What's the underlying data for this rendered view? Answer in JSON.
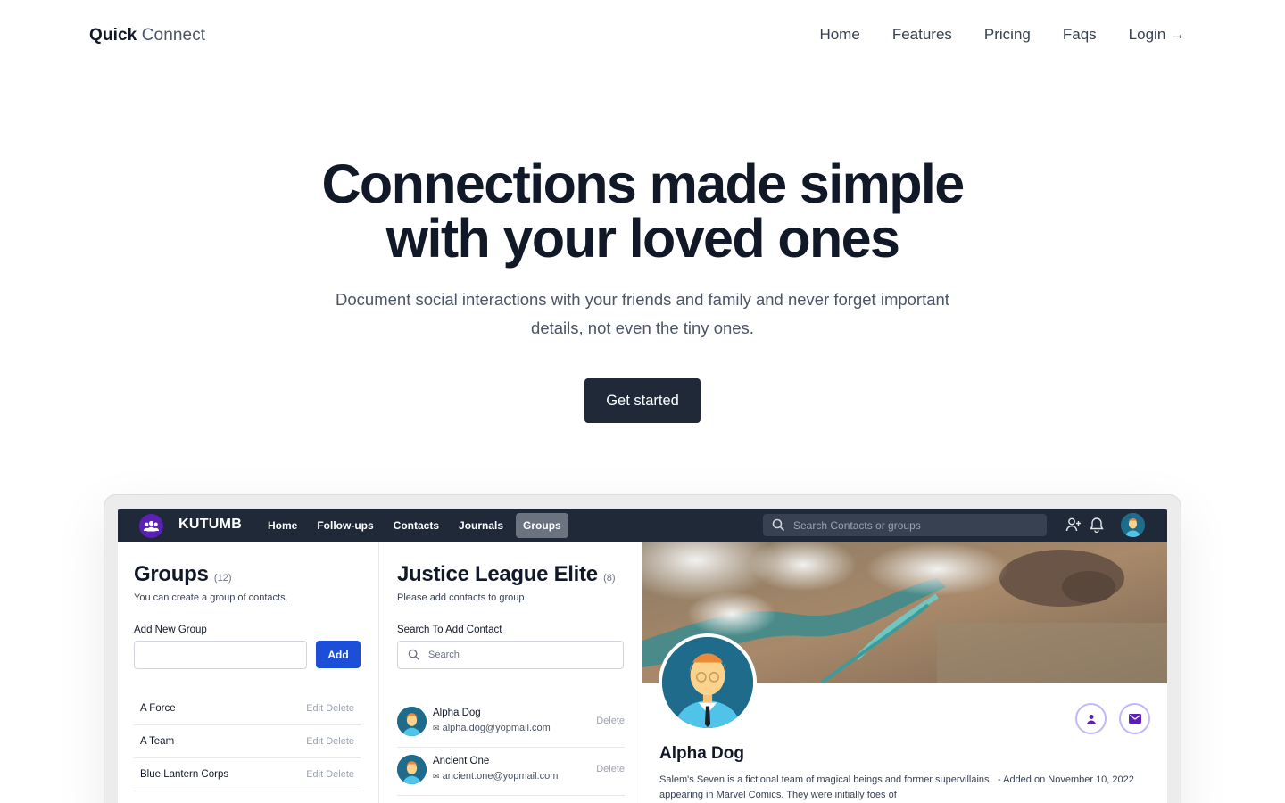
{
  "site": {
    "brand_bold": "Quick",
    "brand_light": "Connect",
    "nav": [
      "Home",
      "Features",
      "Pricing",
      "Faqs",
      "Login →"
    ]
  },
  "hero": {
    "title_line1": "Connections made simple",
    "title_line2": "with your loved ones",
    "subtitle_line1": "Document social interactions with your friends and family and never forget important",
    "subtitle_line2": "details, not even the tiny ones.",
    "cta": "Get started"
  },
  "app": {
    "name": "KUTUMB",
    "menu": [
      "Home",
      "Follow-ups",
      "Contacts",
      "Journals",
      "Groups"
    ],
    "active_menu": "Groups",
    "search_placeholder": "Search Contacts or groups",
    "groups": {
      "title": "Groups",
      "count": "(12)",
      "subtitle": "You can create a group of contacts.",
      "add_label": "Add New Group",
      "add_button": "Add",
      "rows": [
        {
          "name": "A Force",
          "actions": "Edit Delete"
        },
        {
          "name": "A Team",
          "actions": "Edit Delete"
        },
        {
          "name": "Blue Lantern Corps",
          "actions": "Edit Delete"
        }
      ]
    },
    "group_detail": {
      "title": "Justice League Elite",
      "count": "(8)",
      "subtitle": "Please add contacts to group.",
      "search_label": "Search To Add Contact",
      "search_placeholder": "Search",
      "contacts": [
        {
          "name": "Alpha Dog",
          "email": "alpha.dog@yopmail.com",
          "action": "Delete"
        },
        {
          "name": "Ancient One",
          "email": "ancient.one@yopmail.com",
          "action": "Delete"
        }
      ]
    },
    "profile": {
      "name": "Alpha Dog",
      "description": "Salem's Seven is a fictional team of magical beings and former supervillains appearing in Marvel Comics. They were initially foes of",
      "added": "- Added on November 10, 2022"
    }
  },
  "colors": {
    "dark": "#1f2937",
    "accent_blue": "#1d4ed8",
    "accent_purple": "#5b21b6"
  }
}
